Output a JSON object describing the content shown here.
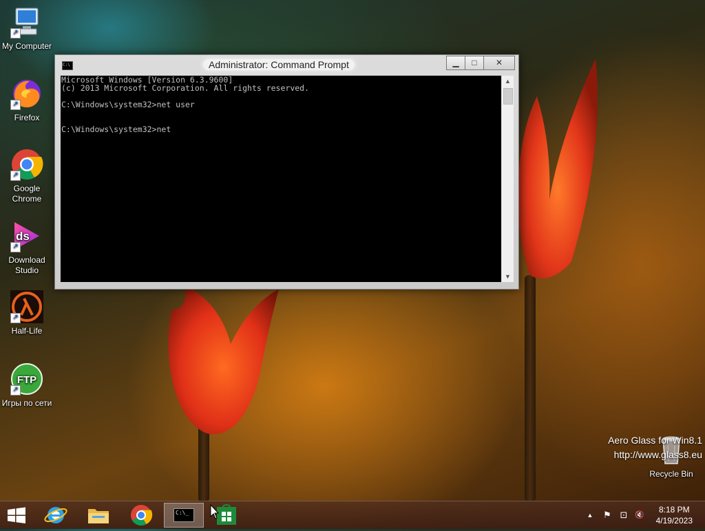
{
  "desktop": {
    "icons": [
      {
        "label": "My Computer"
      },
      {
        "label": "Firefox"
      },
      {
        "label": "Google\nChrome"
      },
      {
        "label": "Download\nStudio"
      },
      {
        "label": "Half-Life"
      },
      {
        "label": "Игры по сети"
      },
      {
        "label": "Recycle Bin"
      }
    ],
    "ftp_badge": "FTP",
    "ds_badge": "ds"
  },
  "window": {
    "title": "Administrator: Command Prompt",
    "console_lines": [
      "Microsoft Windows [Version 6.3.9600]",
      "(c) 2013 Microsoft Corporation. All rights reserved.",
      "",
      "C:\\Windows\\system32>net user",
      "",
      "",
      "C:\\Windows\\system32>net"
    ],
    "icon_text": "C:\\",
    "minimize_glyph": "▁",
    "maximize_glyph": "□",
    "close_glyph": "✕"
  },
  "watermark": {
    "line1": "Aero Glass for Win8.1",
    "line2": "http://www.glass8.eu"
  },
  "taskbar": {
    "cmd_icon_text": "C:\\_",
    "tray_glyphs": {
      "arrow": "▲",
      "flag": "⚑",
      "network": "⊡",
      "volume": "🔇"
    },
    "clock_time": "8:18 PM",
    "clock_date": "4/19/2023"
  },
  "colors": {
    "console_bg": "#000000",
    "console_fg": "#c0c0c0",
    "close_button": "#c9c9c9"
  }
}
